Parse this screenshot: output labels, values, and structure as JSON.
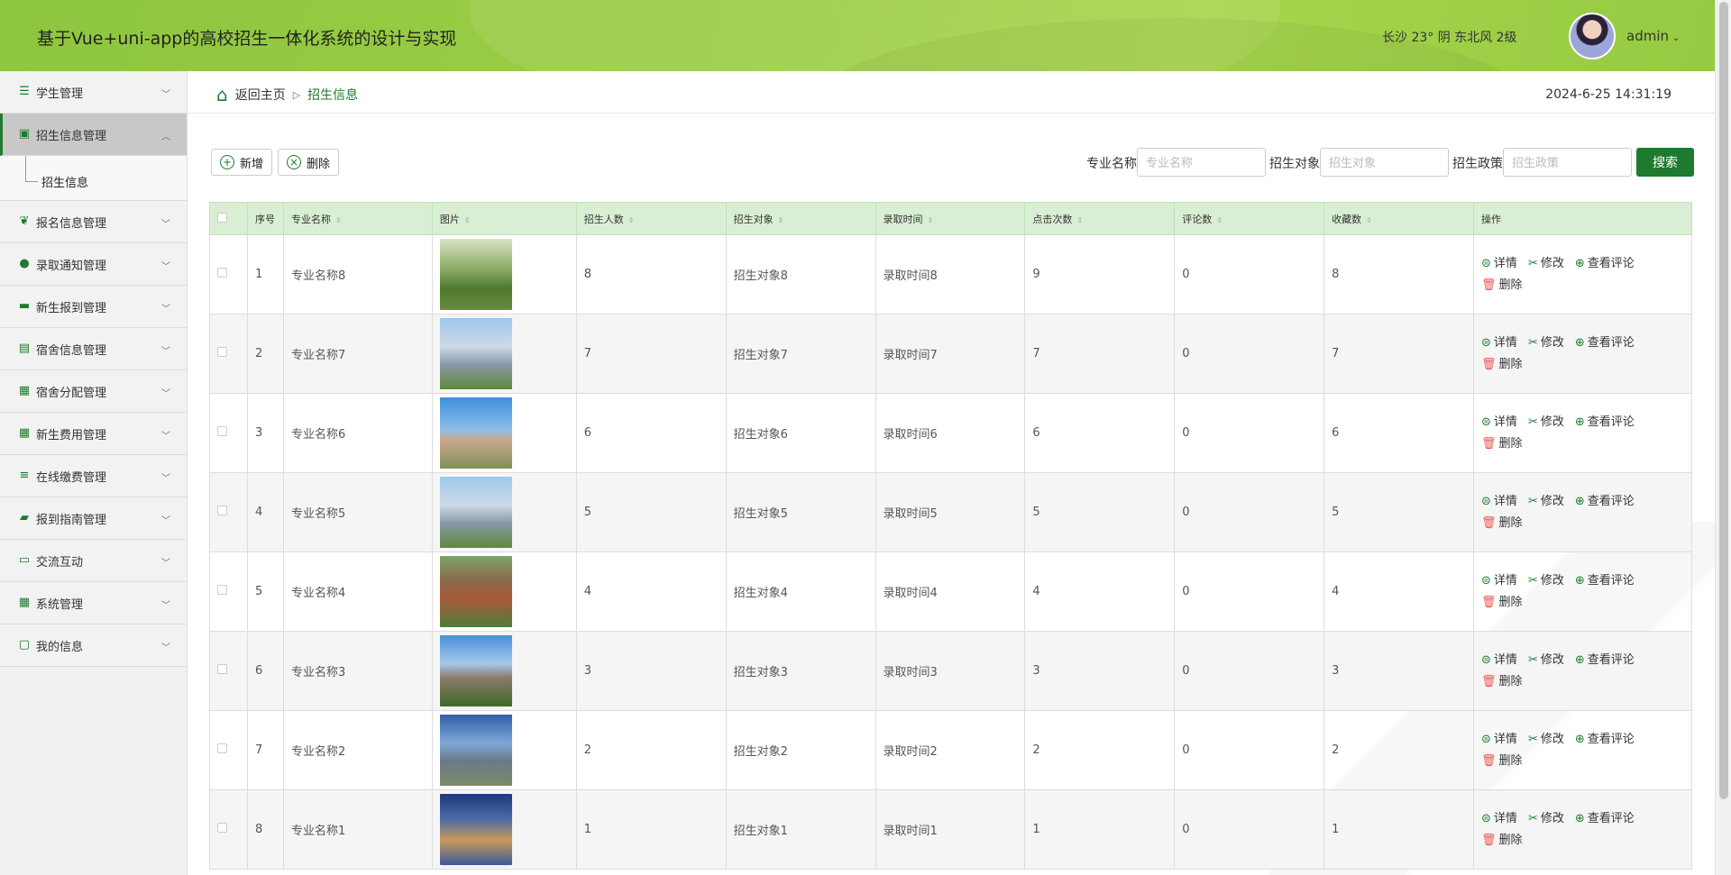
{
  "app_title": "基于Vue+uni-app的高校招生一体化系统的设计与实现",
  "weather": "长沙 23° 阴 东北风 2级",
  "user": {
    "name": "admin"
  },
  "sidebar": {
    "items": [
      {
        "label": "学生管理",
        "icon": "list-icon"
      },
      {
        "label": "招生信息管理",
        "icon": "briefcase-icon",
        "active": true
      },
      {
        "label": "报名信息管理",
        "icon": "leaf-icon"
      },
      {
        "label": "录取通知管理",
        "icon": "user-icon"
      },
      {
        "label": "新生报到管理",
        "icon": "laptop-icon"
      },
      {
        "label": "宿舍信息管理",
        "icon": "clipboard-icon"
      },
      {
        "label": "宿舍分配管理",
        "icon": "grid-icon"
      },
      {
        "label": "新生费用管理",
        "icon": "grid-icon"
      },
      {
        "label": "在线缴费管理",
        "icon": "sliders-icon"
      },
      {
        "label": "报到指南管理",
        "icon": "book-icon"
      },
      {
        "label": "交流互动",
        "icon": "chat-icon"
      },
      {
        "label": "系统管理",
        "icon": "grid-icon"
      },
      {
        "label": "我的信息",
        "icon": "id-card-icon"
      }
    ],
    "submenu_label": "招生信息"
  },
  "breadcrumb": {
    "home": "返回主页",
    "current": "招生信息"
  },
  "clock": "2024-6-25 14:31:19",
  "toolbar": {
    "add_label": "新增",
    "delete_label": "删除"
  },
  "search": {
    "fields": [
      {
        "label": "专业名称",
        "placeholder": "专业名称"
      },
      {
        "label": "招生对象",
        "placeholder": "招生对象"
      },
      {
        "label": "招生政策",
        "placeholder": "招生政策"
      }
    ],
    "button": "搜索"
  },
  "table": {
    "headers": [
      "序号",
      "专业名称",
      "图片",
      "招生人数",
      "招生对象",
      "录取时间",
      "点击次数",
      "评论数",
      "收藏数",
      "操作"
    ],
    "rows": [
      {
        "no": "1",
        "name": "专业名称8",
        "count": "8",
        "target": "招生对象8",
        "time": "录取时间8",
        "clicks": "9",
        "comments": "0",
        "favs": "8"
      },
      {
        "no": "2",
        "name": "专业名称7",
        "count": "7",
        "target": "招生对象7",
        "time": "录取时间7",
        "clicks": "7",
        "comments": "0",
        "favs": "7"
      },
      {
        "no": "3",
        "name": "专业名称6",
        "count": "6",
        "target": "招生对象6",
        "time": "录取时间6",
        "clicks": "6",
        "comments": "0",
        "favs": "6"
      },
      {
        "no": "4",
        "name": "专业名称5",
        "count": "5",
        "target": "招生对象5",
        "time": "录取时间5",
        "clicks": "5",
        "comments": "0",
        "favs": "5"
      },
      {
        "no": "5",
        "name": "专业名称4",
        "count": "4",
        "target": "招生对象4",
        "time": "录取时间4",
        "clicks": "4",
        "comments": "0",
        "favs": "4"
      },
      {
        "no": "6",
        "name": "专业名称3",
        "count": "3",
        "target": "招生对象3",
        "time": "录取时间3",
        "clicks": "3",
        "comments": "0",
        "favs": "3"
      },
      {
        "no": "7",
        "name": "专业名称2",
        "count": "2",
        "target": "招生对象2",
        "time": "录取时间2",
        "clicks": "2",
        "comments": "0",
        "favs": "2"
      },
      {
        "no": "8",
        "name": "专业名称1",
        "count": "1",
        "target": "招生对象1",
        "time": "录取时间1",
        "clicks": "1",
        "comments": "0",
        "favs": "1"
      }
    ],
    "ops": {
      "detail": "详情",
      "edit": "修改",
      "comments": "查看评论",
      "delete": "删除"
    }
  },
  "colors": {
    "header": "#9acd45",
    "accent": "#1e7a2e",
    "table_header": "#d9efd3"
  }
}
